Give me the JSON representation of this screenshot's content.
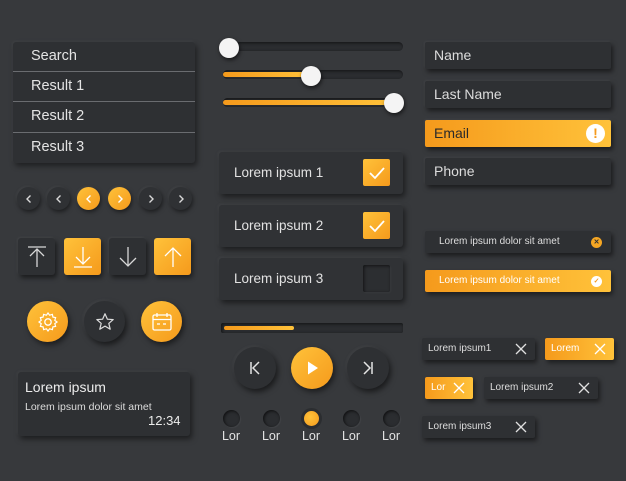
{
  "search": {
    "label": "Search",
    "results": [
      "Result 1",
      "Result 2",
      "Result 3"
    ]
  },
  "pagination": {
    "buttons": [
      "chevron-left-icon",
      "chevron-left-icon",
      "chevron-left-icon",
      "chevron-right-icon",
      "chevron-right-icon",
      "chevron-right-icon"
    ],
    "active_indices": [
      2,
      3
    ]
  },
  "arrow_buttons": [
    {
      "icon": "upload-top-icon",
      "style": "dark"
    },
    {
      "icon": "download-icon",
      "style": "orange"
    },
    {
      "icon": "arrow-down-icon",
      "style": "dark"
    },
    {
      "icon": "arrow-up-icon",
      "style": "orange"
    }
  ],
  "icon_buttons": [
    {
      "icon": "gear-icon",
      "style": "orange"
    },
    {
      "icon": "star-icon",
      "style": "dark"
    },
    {
      "icon": "calendar-icon",
      "style": "orange"
    }
  ],
  "notification": {
    "title": "Lorem ipsum",
    "body": "Lorem ipsum dolor sit amet",
    "time": "12:34"
  },
  "sliders": [
    {
      "level": 0.0
    },
    {
      "level": 0.48
    },
    {
      "level": 1.0
    }
  ],
  "checkboxes": [
    {
      "label": "Lorem ipsum 1",
      "checked": true
    },
    {
      "label": "Lorem ipsum 2",
      "checked": true
    },
    {
      "label": "Lorem ipsum 3",
      "checked": false
    }
  ],
  "player": {
    "progress": 0.39,
    "controls": [
      "skip-back-icon",
      "play-icon",
      "skip-forward-icon"
    ]
  },
  "radios": {
    "labels": [
      "Lor",
      "Lor",
      "Lor",
      "Lor",
      "Lor"
    ],
    "selected_index": 2
  },
  "form": {
    "name": "Name",
    "last_name": "Last Name",
    "email": "Email",
    "phone": "Phone",
    "email_warning_icon": "!"
  },
  "alerts": [
    {
      "text": "Lorem ipsum dolor sit amet",
      "style": "dark",
      "icon": "close-icon"
    },
    {
      "text": "Lorem ipsum dolor sit amet",
      "style": "orange",
      "icon": "check-icon"
    }
  ],
  "tags": [
    {
      "text": "Lorem ipsum1",
      "style": "dark"
    },
    {
      "text": "Lorem",
      "style": "orange"
    },
    {
      "text": "Lor",
      "style": "orange"
    },
    {
      "text": "Lorem ipsum2",
      "style": "dark"
    },
    {
      "text": "Lorem ipsum3",
      "style": "dark"
    }
  ],
  "colors": {
    "background": "#37393c",
    "panel": "#2e3033",
    "accent_start": "#f59a1c",
    "accent_end": "#ffc23a",
    "text": "#e4e4e4"
  }
}
